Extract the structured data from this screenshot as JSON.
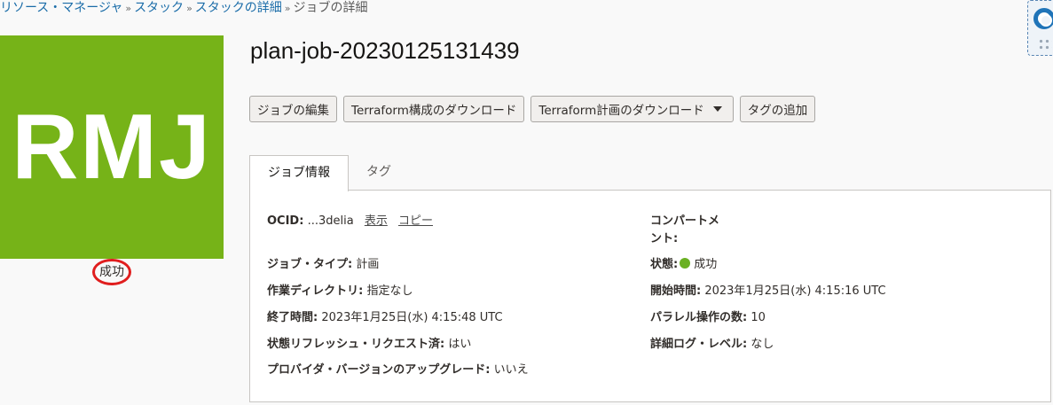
{
  "breadcrumb": {
    "items": [
      "リソース・マネージャ",
      "スタック",
      "スタックの詳細"
    ],
    "separator": "»",
    "current": "ジョブの詳細"
  },
  "logo": {
    "text": "RMJ",
    "color": "#76b318"
  },
  "logo_status": "成功",
  "title": "plan-job-20230125131439",
  "actions": {
    "edit": "ジョブの編集",
    "download_config": "Terraform構成のダウンロード",
    "download_plan": "Terraform計画のダウンロード",
    "add_tag": "タグの追加"
  },
  "tabs": [
    "ジョブ情報",
    "タグ"
  ],
  "info": {
    "ocid": {
      "label": "OCID:",
      "value": "...3delia",
      "show": "表示",
      "copy": "コピー"
    },
    "compartment": {
      "label": "コンパートメ",
      "label2": "ント:"
    },
    "job_type": {
      "label": "ジョブ・タイプ:",
      "value": "計画"
    },
    "status": {
      "label": "状態:",
      "value": "成功",
      "color": "#6ab023"
    },
    "working_dir": {
      "label": "作業ディレクトリ:",
      "value": "指定なし"
    },
    "start_time": {
      "label": "開始時間:",
      "value": "2023年1月25日(水) 4:15:16 UTC"
    },
    "end_time": {
      "label": "終了時間:",
      "value": "2023年1月25日(水) 4:15:48 UTC"
    },
    "parallel": {
      "label": "パラレル操作の数:",
      "value": "10"
    },
    "refresh": {
      "label": "状態リフレッシュ・リクエスト済:",
      "value": "はい"
    },
    "log_level": {
      "label": "詳細ログ・レベル:",
      "value": "なし"
    },
    "provider_upgrade": {
      "label": "プロバイダ・バージョンのアップグレード:",
      "value": "いいえ"
    }
  }
}
